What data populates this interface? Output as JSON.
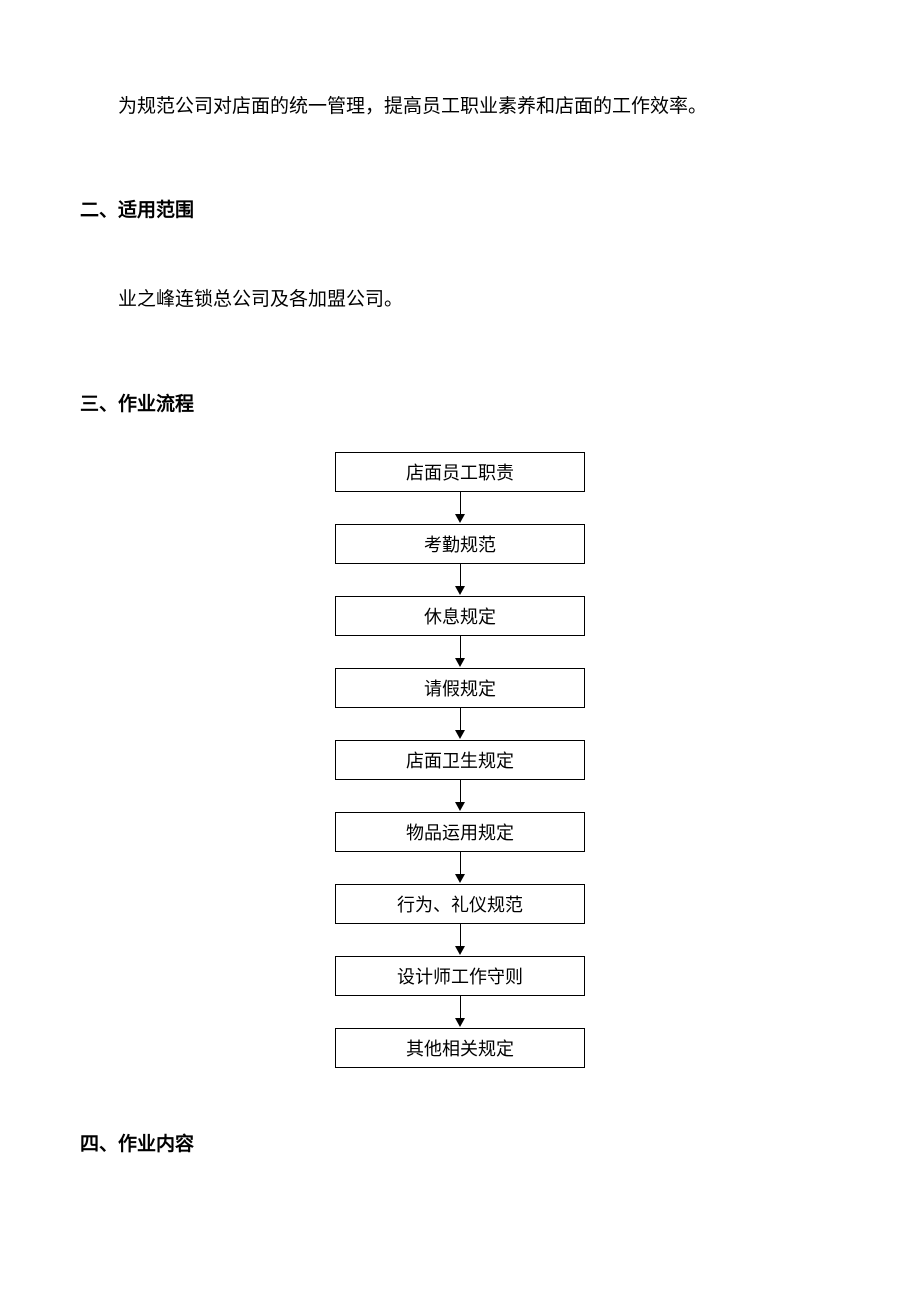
{
  "section1": {
    "body": "为规范公司对店面的统一管理，提高员工职业素养和店面的工作效率。"
  },
  "section2": {
    "heading": "二、适用范围",
    "body": "业之峰连锁总公司及各加盟公司。"
  },
  "section3": {
    "heading": "三、作业流程"
  },
  "section4": {
    "heading": "四、作业内容"
  },
  "flowchart": {
    "steps": [
      "店面员工职责",
      "考勤规范",
      "休息规定",
      "请假规定",
      "店面卫生规定",
      "物品运用规定",
      "行为、礼仪规范",
      "设计师工作守则",
      "其他相关规定"
    ]
  }
}
